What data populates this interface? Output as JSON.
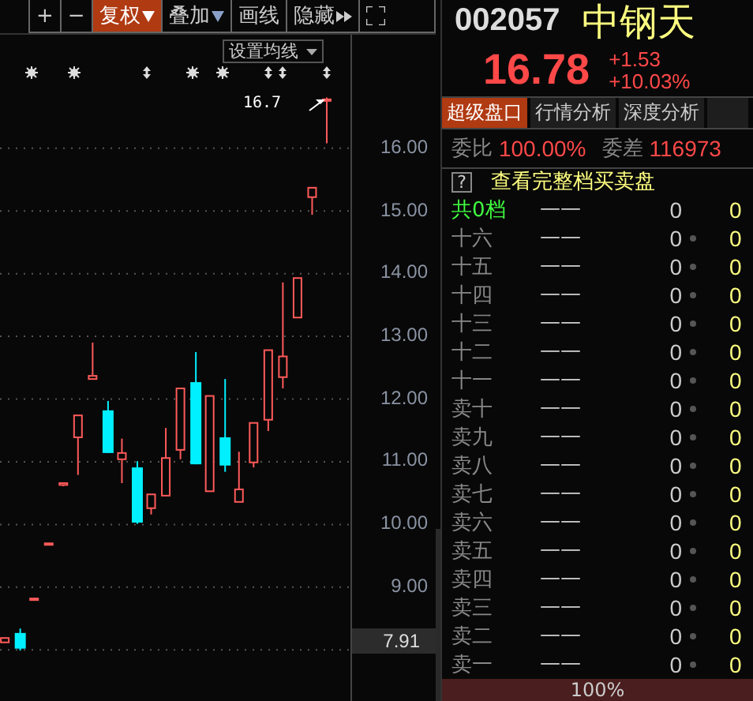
{
  "toolbar": {
    "buttons": [
      {
        "label": "+",
        "kind": "plain",
        "selected": false
      },
      {
        "label": "−",
        "kind": "plain",
        "selected": false
      },
      {
        "label": "复权",
        "kind": "dropdown",
        "selected": true
      },
      {
        "label": "叠加",
        "kind": "dropdown",
        "selected": false
      },
      {
        "label": "画线",
        "kind": "plain",
        "selected": false
      },
      {
        "label": "隐藏",
        "kind": "expand",
        "selected": false
      },
      {
        "kind": "fullscreen",
        "selected": false
      }
    ]
  },
  "chart": {
    "ma_button": "设置均线",
    "last_price_label": "16.7",
    "current_price": "7.91",
    "chart_data": {
      "type": "candlestick",
      "grid": true,
      "ohlc": [
        [
          8.12,
          8.19,
          8.12,
          8.19
        ],
        [
          8.27,
          8.34,
          7.99,
          8.02
        ],
        [
          8.8,
          8.82,
          8.8,
          8.82
        ],
        [
          9.68,
          9.7,
          9.68,
          9.7
        ],
        [
          10.63,
          10.66,
          10.61,
          10.66
        ],
        [
          11.39,
          11.74,
          10.79,
          11.74
        ],
        [
          12.32,
          12.9,
          12.32,
          12.37
        ],
        [
          11.82,
          11.97,
          11.14,
          11.14
        ],
        [
          11.04,
          11.37,
          10.66,
          11.14
        ],
        [
          10.91,
          11.01,
          10.01,
          10.03
        ],
        [
          10.26,
          10.48,
          10.16,
          10.48
        ],
        [
          10.46,
          11.54,
          10.46,
          11.06
        ],
        [
          11.19,
          12.17,
          11.04,
          12.17
        ],
        [
          12.27,
          12.75,
          10.96,
          10.96
        ],
        [
          10.53,
          12.05,
          10.53,
          12.05
        ],
        [
          11.39,
          12.32,
          10.84,
          10.94
        ],
        [
          10.36,
          11.16,
          10.36,
          10.56
        ],
        [
          10.99,
          11.62,
          10.91,
          11.62
        ],
        [
          11.67,
          12.78,
          11.49,
          12.78
        ],
        [
          12.35,
          13.86,
          12.17,
          12.68
        ],
        [
          13.3,
          13.93,
          13.3,
          13.93
        ],
        [
          15.22,
          15.37,
          14.94,
          15.37
        ],
        [
          16.76,
          16.81,
          16.08,
          16.78
        ]
      ],
      "ylim": [
        7.16,
        17.81
      ],
      "yticks": [
        {
          "value": 16,
          "label": "16.00"
        },
        {
          "value": 15,
          "label": "15.00"
        },
        {
          "value": 14,
          "label": "14.00"
        },
        {
          "value": 13,
          "label": "13.00"
        },
        {
          "value": 12,
          "label": "12.00"
        },
        {
          "value": 11,
          "label": "11.00"
        },
        {
          "value": 10,
          "label": "10.00"
        },
        {
          "value": 9,
          "label": "9.00"
        }
      ]
    }
  },
  "quote": {
    "code": "002057",
    "name": "中钢天",
    "price": "16.78",
    "change": "+1.53",
    "change_percent": "+10.03%"
  },
  "tabs": [
    {
      "label": "超级盘口",
      "selected": true
    },
    {
      "label": "行情分析",
      "selected": false
    },
    {
      "label": "深度分析",
      "selected": false
    }
  ],
  "stats": [
    {
      "label": "委比",
      "value": "100.00%"
    },
    {
      "label": "委差",
      "value": "116973"
    }
  ],
  "order_book": {
    "help": "?",
    "title": "查看完整档买卖盘",
    "rows": [
      {
        "label": "共0档",
        "kind": "total",
        "price": "——",
        "volume": "0",
        "column_4": "0"
      },
      {
        "label": "十六",
        "kind": "level",
        "price": "——",
        "volume": "0",
        "column_4": "0"
      },
      {
        "label": "十五",
        "kind": "level",
        "price": "——",
        "volume": "0",
        "column_4": "0"
      },
      {
        "label": "十四",
        "kind": "level",
        "price": "——",
        "volume": "0",
        "column_4": "0"
      },
      {
        "label": "十三",
        "kind": "level",
        "price": "——",
        "volume": "0",
        "column_4": "0"
      },
      {
        "label": "十二",
        "kind": "level",
        "price": "——",
        "volume": "0",
        "column_4": "0"
      },
      {
        "label": "十一",
        "kind": "level",
        "price": "——",
        "volume": "0",
        "column_4": "0"
      },
      {
        "label": "卖十",
        "kind": "level",
        "price": "——",
        "volume": "0",
        "column_4": "0"
      },
      {
        "label": "卖九",
        "kind": "level",
        "price": "——",
        "volume": "0",
        "column_4": "0"
      },
      {
        "label": "卖八",
        "kind": "level",
        "price": "——",
        "volume": "0",
        "column_4": "0"
      },
      {
        "label": "卖七",
        "kind": "level",
        "price": "——",
        "volume": "0",
        "column_4": "0"
      },
      {
        "label": "卖六",
        "kind": "level",
        "price": "——",
        "volume": "0",
        "column_4": "0"
      },
      {
        "label": "卖五",
        "kind": "level",
        "price": "——",
        "volume": "0",
        "column_4": "0"
      },
      {
        "label": "卖四",
        "kind": "level",
        "price": "——",
        "volume": "0",
        "column_4": "0"
      },
      {
        "label": "卖三",
        "kind": "level",
        "price": "——",
        "volume": "0",
        "column_4": "0"
      },
      {
        "label": "卖二",
        "kind": "level",
        "price": "——",
        "volume": "0",
        "column_4": "0"
      },
      {
        "label": "卖一",
        "kind": "level",
        "price": "——",
        "volume": "0",
        "column_4": "0"
      }
    ],
    "footer": "100%"
  }
}
